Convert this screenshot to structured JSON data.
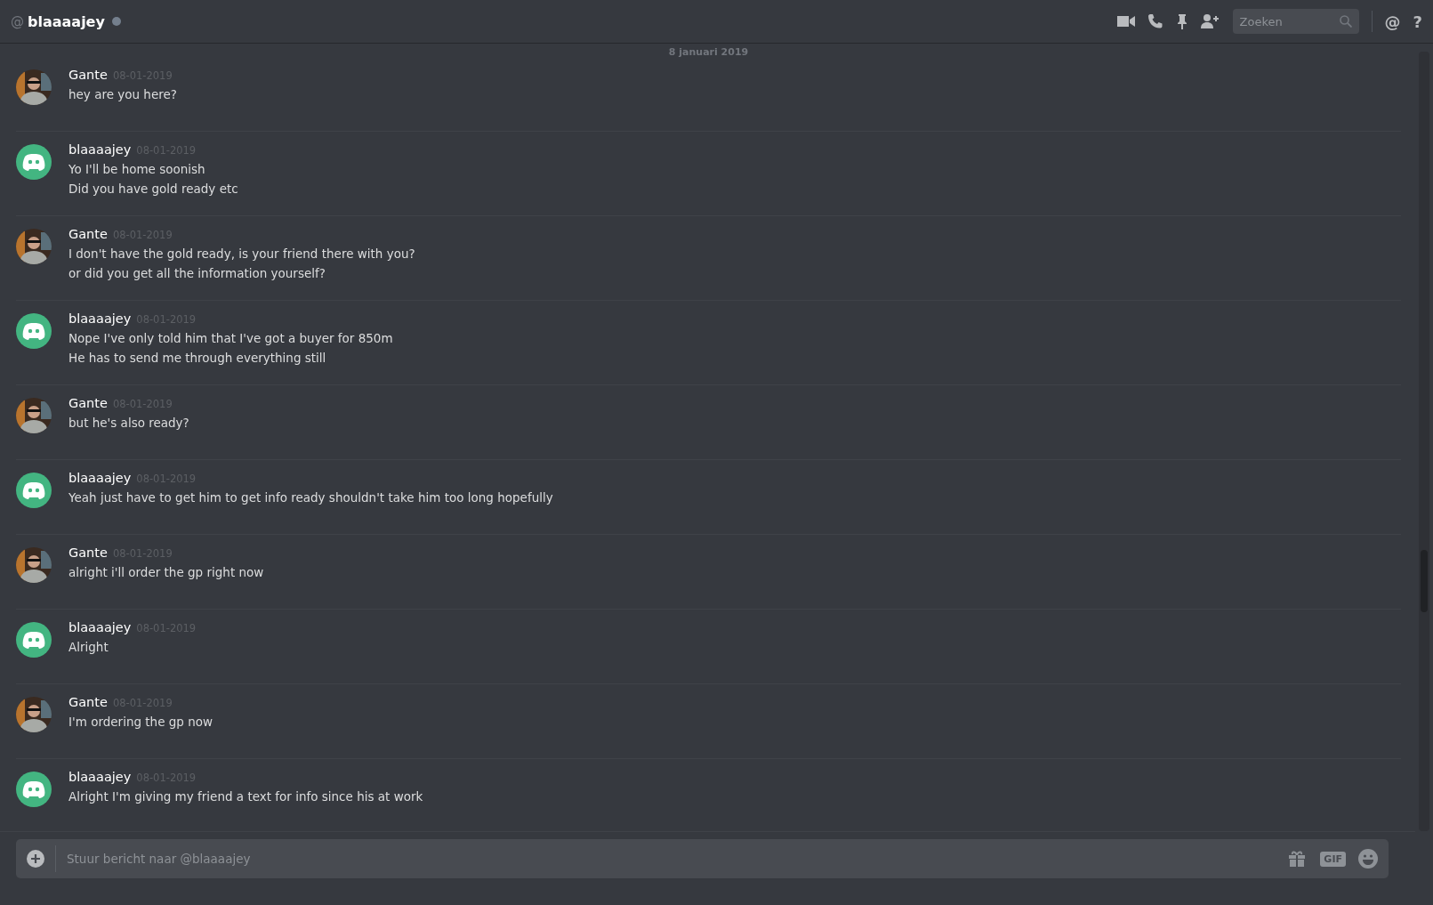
{
  "header": {
    "at": "@",
    "title": "blaaaajey",
    "search": {
      "placeholder": "Zoeken"
    },
    "help": "?"
  },
  "date_divider": "8 januari 2019",
  "messages": [
    {
      "author": "Gante",
      "kind": "photo",
      "time": "08-01-2019",
      "lines": [
        "hey are you here?"
      ]
    },
    {
      "author": "blaaaajey",
      "kind": "default",
      "time": "08-01-2019",
      "lines": [
        "Yo I'll be home soonish",
        "Did you have gold ready etc"
      ]
    },
    {
      "author": "Gante",
      "kind": "photo",
      "time": "08-01-2019",
      "lines": [
        "I don't have the gold ready, is your friend there with you?",
        "or did you get all the information yourself?"
      ]
    },
    {
      "author": "blaaaajey",
      "kind": "default",
      "time": "08-01-2019",
      "lines": [
        "Nope I've only told him that I've got a buyer for 850m",
        "He has to send me through everything still"
      ]
    },
    {
      "author": "Gante",
      "kind": "photo",
      "time": "08-01-2019",
      "lines": [
        "but he's also ready?"
      ]
    },
    {
      "author": "blaaaajey",
      "kind": "default",
      "time": "08-01-2019",
      "lines": [
        "Yeah just have to get him to get info ready shouldn't take him too long hopefully"
      ]
    },
    {
      "author": "Gante",
      "kind": "photo",
      "time": "08-01-2019",
      "lines": [
        "alright i'll order the gp right now"
      ]
    },
    {
      "author": "blaaaajey",
      "kind": "default",
      "time": "08-01-2019",
      "lines": [
        "Alright"
      ]
    },
    {
      "author": "Gante",
      "kind": "photo",
      "time": "08-01-2019",
      "lines": [
        "I'm ordering the gp now"
      ]
    },
    {
      "author": "blaaaajey",
      "kind": "default",
      "time": "08-01-2019",
      "lines": [
        "Alright I'm giving my friend a text for info since his at work"
      ]
    }
  ],
  "composer": {
    "placeholder": "Stuur bericht naar @blaaaajey",
    "gif": "GIF"
  }
}
